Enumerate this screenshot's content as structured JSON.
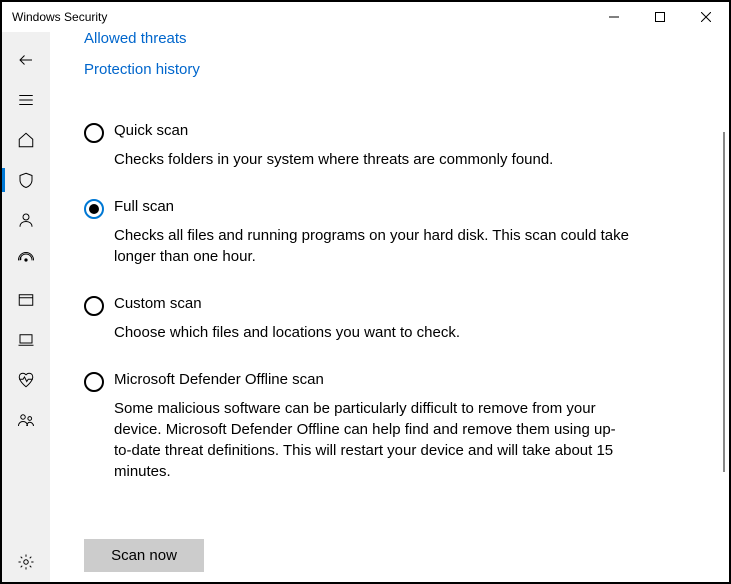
{
  "window": {
    "title": "Windows Security"
  },
  "links": {
    "allowed_threats": "Allowed threats",
    "protection_history": "Protection history"
  },
  "options": {
    "quick": {
      "title": "Quick scan",
      "desc": "Checks folders in your system where threats are commonly found."
    },
    "full": {
      "title": "Full scan",
      "desc": "Checks all files and running programs on your hard disk. This scan could take longer than one hour."
    },
    "custom": {
      "title": "Custom scan",
      "desc": "Choose which files and locations you want to check."
    },
    "offline": {
      "title": "Microsoft Defender Offline scan",
      "desc": "Some malicious software can be particularly difficult to remove from your device. Microsoft Defender Offline can help find and remove them using up-to-date threat definitions. This will restart your device and will take about 15 minutes."
    }
  },
  "button": {
    "scan_now": "Scan now"
  }
}
